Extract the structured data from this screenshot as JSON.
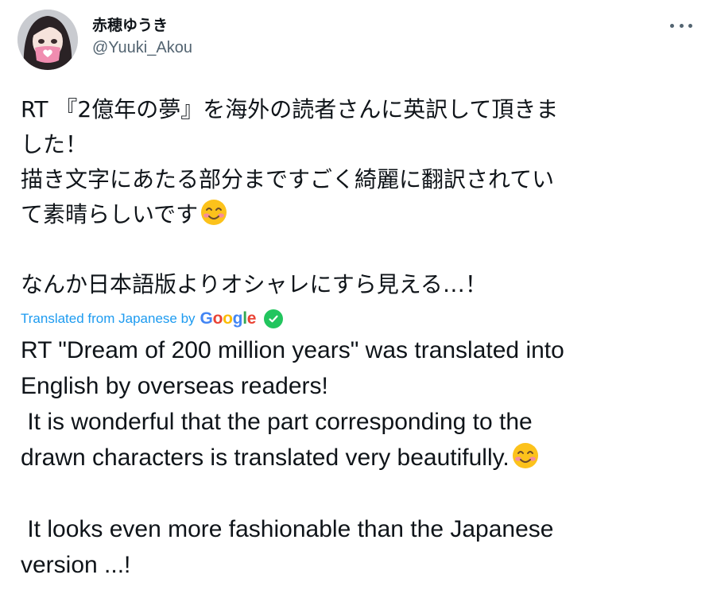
{
  "user": {
    "display_name": "赤穂ゆうき",
    "handle": "@Yuuki_Akou",
    "avatar_icon": "avatar-girl-heart-mask"
  },
  "tweet": {
    "jp_lines": [
      "RT 『2億年の夢』を海外の読者さんに英訳して頂きま",
      "した！",
      "描き文字にあたる部分まですごく綺麗に翻訳されてい",
      "て素晴らしいです",
      "",
      "なんか日本語版よりオシャレにすら見える…！"
    ],
    "translation_label": "Translated from Japanese by",
    "google_letters": [
      "G",
      "o",
      "o",
      "g",
      "l",
      "e"
    ],
    "google_colors": [
      "#4285f4",
      "#ea4335",
      "#fbbc05",
      "#4285f4",
      "#34a853",
      "#ea4335"
    ],
    "en_lines": [
      "RT \"Dream of 200 million years\" was translated into",
      "English by overseas readers!",
      " It is wonderful that the part corresponding to the",
      "drawn characters is translated very beautifully.",
      "",
      " It looks even more fashionable than the Japanese",
      "version ...!"
    ],
    "emoji_icon": "smiling-face-with-smiling-eyes"
  },
  "colors": {
    "link_blue": "#1d9bf0",
    "secondary_text": "#536471",
    "check_green": "#22c55e"
  }
}
